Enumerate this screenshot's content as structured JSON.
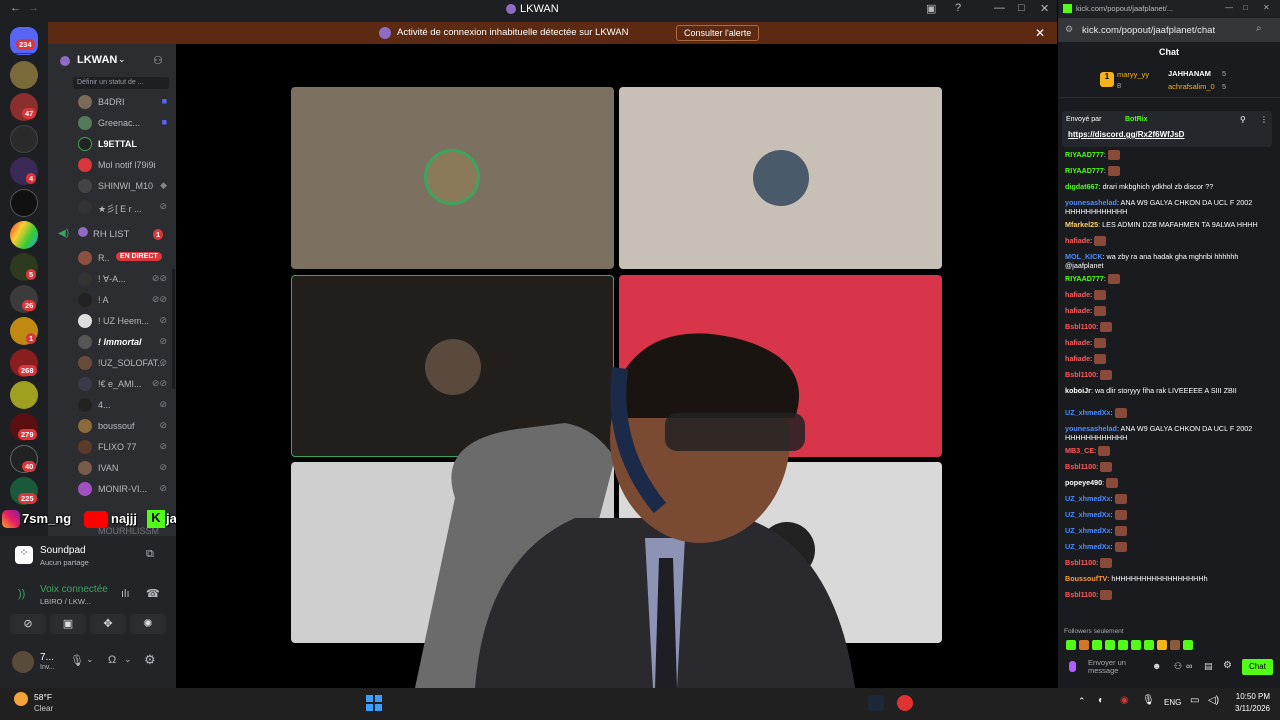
{
  "window": {
    "title": "LKWAN"
  },
  "alert": {
    "message": "Activité de connexion inhabituelle détectée sur LKWAN",
    "button": "Consulter l'alerte"
  },
  "servers": {
    "dm_badge": "234",
    "badges": [
      "47",
      "4",
      "5",
      "26",
      "1",
      "268",
      "279",
      "40",
      "225"
    ]
  },
  "guild": {
    "name": "LKWAN",
    "status_prompt": "Définir un statut de ...",
    "members": [
      {
        "name": "B4DRI"
      },
      {
        "name": "Greenac..."
      },
      {
        "name": "L9ETTAL"
      },
      {
        "name": "Mol notif l79i9i"
      },
      {
        "name": "SHINWI_M10"
      },
      {
        "name": "★彡[ E r ..."
      }
    ],
    "voice_channel": {
      "name": "RH LIST",
      "count": "1"
    },
    "voice_users": [
      {
        "name": "R..",
        "live": "EN DIRECT"
      },
      {
        "name": "! ∀-A..."
      },
      {
        "name": "! A"
      },
      {
        "name": "! UZ Heem..."
      },
      {
        "name": "! Immortal"
      },
      {
        "name": "!UZ_SOLOFAT..."
      },
      {
        "name": "!€ e_AMI..."
      },
      {
        "name": "4..."
      },
      {
        "name": "boussouf"
      },
      {
        "name": "FLIXO 77"
      },
      {
        "name": "IVAN"
      },
      {
        "name": "MONIR-VI..."
      },
      {
        "name": "MOURHLISSM"
      }
    ]
  },
  "stream_overlay": {
    "instagram": "7sm_ng",
    "youtube": "najjj",
    "kick": "jaafplanet"
  },
  "soundpad": {
    "title": "Soundpad",
    "subtitle": "Aucun partage"
  },
  "voice": {
    "status": "Voix connectée",
    "channel": "LBIRO / LKW..."
  },
  "user": {
    "name": "7...",
    "status": "Inv..."
  },
  "kick": {
    "url": "kick.com/popout/jaafplanet/chat",
    "tab_url": "kick.com/popout/jaafplanet/...",
    "header": "Chat",
    "gifters": [
      {
        "rank": "1",
        "name": "maryy_yy",
        "count": "8"
      },
      {
        "name": "JAHHANAM",
        "count": "5"
      },
      {
        "name": "achrafsalim_0",
        "count": "5"
      }
    ],
    "pinned": {
      "by_label": "Envoyé par",
      "by": "BotRix",
      "link": "https://discord.gg/Rx2f6WfJsD"
    },
    "messages": [
      {
        "user": "RIYAAD777",
        "text": "",
        "color": "#53fc18"
      },
      {
        "user": "RIYAAD777",
        "text": "",
        "color": "#53fc18"
      },
      {
        "user": "digdat667",
        "text": "drari mkbghich ydkhol zb discor ??",
        "color": "#53fc18"
      },
      {
        "user": "younesashelad",
        "text": "ANA W9 GALYA CHKON DA UCL F 2002 HHHHHHHHHHHH",
        "color": "#4e8cff"
      },
      {
        "user": "Mfarkel25",
        "text": "LES ADMIN DZB MAFAHMEN TA 9ALWA HHHH",
        "color": "#ffd166"
      },
      {
        "user": "hafiade",
        "text": "",
        "color": "#ff5b5b"
      },
      {
        "user": "MOL_KICK",
        "text": "wa zby ra ana hadak gha mghribi hhhhhh @jaafplanet",
        "color": "#4e8cff"
      },
      {
        "user": "RIYAAD777",
        "text": "",
        "color": "#53fc18"
      },
      {
        "user": "hafiade",
        "text": "",
        "color": "#ff5b5b"
      },
      {
        "user": "hafiade",
        "text": "",
        "color": "#ff5b5b"
      },
      {
        "user": "Bsbl1100",
        "text": "",
        "color": "#ff5b5b"
      },
      {
        "user": "hafiade",
        "text": "",
        "color": "#ff5b5b"
      },
      {
        "user": "hafiade",
        "text": "",
        "color": "#ff5b5b"
      },
      {
        "user": "Bsbl1100",
        "text": "",
        "color": "#ff5b5b"
      },
      {
        "user": "koboiJr",
        "text": "wa dlir storyyy fiha rak LIVEEEEE A SIII ZBII",
        "color": "#ffffff"
      },
      {
        "user": "UZ_xhmedXx",
        "text": "",
        "color": "#4e8cff"
      },
      {
        "user": "younesashelad",
        "text": "ANA W9 GALYA CHKON DA UCL F 2002 HHHHHHHHHHHH",
        "color": "#4e8cff"
      },
      {
        "user": "MB3_CE",
        "text": "",
        "color": "#ff5b5b"
      },
      {
        "user": "Bsbl1100",
        "text": "",
        "color": "#ff5b5b"
      },
      {
        "user": "popeye490",
        "text": "",
        "color": "#ffffff"
      },
      {
        "user": "UZ_xhmedXx",
        "text": "",
        "color": "#4e8cff"
      },
      {
        "user": "UZ_xhmedXx",
        "text": "",
        "color": "#4e8cff"
      },
      {
        "user": "UZ_xhmedXx",
        "text": "",
        "color": "#4e8cff"
      },
      {
        "user": "UZ_xhmedXx",
        "text": "",
        "color": "#4e8cff"
      },
      {
        "user": "Bsbl1100",
        "text": "",
        "color": "#ff5b5b"
      },
      {
        "user": "BoussoufTV",
        "text": "hHHHHHHHHHHHHHHHHHh",
        "color": "#ff9b3d"
      },
      {
        "user": "Bsbl1100",
        "text": "",
        "color": "#ff5b5b"
      }
    ],
    "followers_only": "Followers seulement",
    "input_placeholder": "Envoyer un message",
    "send_button": "Chat"
  },
  "taskbar": {
    "temp": "58°F",
    "weather": "Clear",
    "lang": "ENG",
    "time": "10:50 PM",
    "date": "3/11/2026"
  },
  "colors": {
    "kick_green": "#53fc18",
    "discord_bg": "#1e1f22",
    "alert_bg": "#5c2a12"
  }
}
